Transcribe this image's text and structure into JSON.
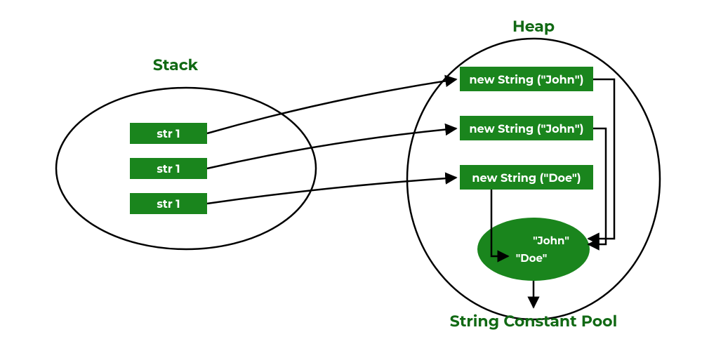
{
  "stack": {
    "title": "Stack",
    "items": [
      "str 1",
      "str 1",
      "str 1"
    ]
  },
  "heap": {
    "title": "Heap",
    "objects": [
      "new String (\"John\")",
      "new String (\"John\")",
      "new String (\"Doe\")"
    ],
    "pool_title": "String Constant Pool",
    "pool_values": [
      "\"John\"",
      "\"Doe\""
    ]
  },
  "colors": {
    "accent": "#116914",
    "box": "#1a851d",
    "text_on_box": "#ffffff",
    "stroke": "#000000"
  }
}
